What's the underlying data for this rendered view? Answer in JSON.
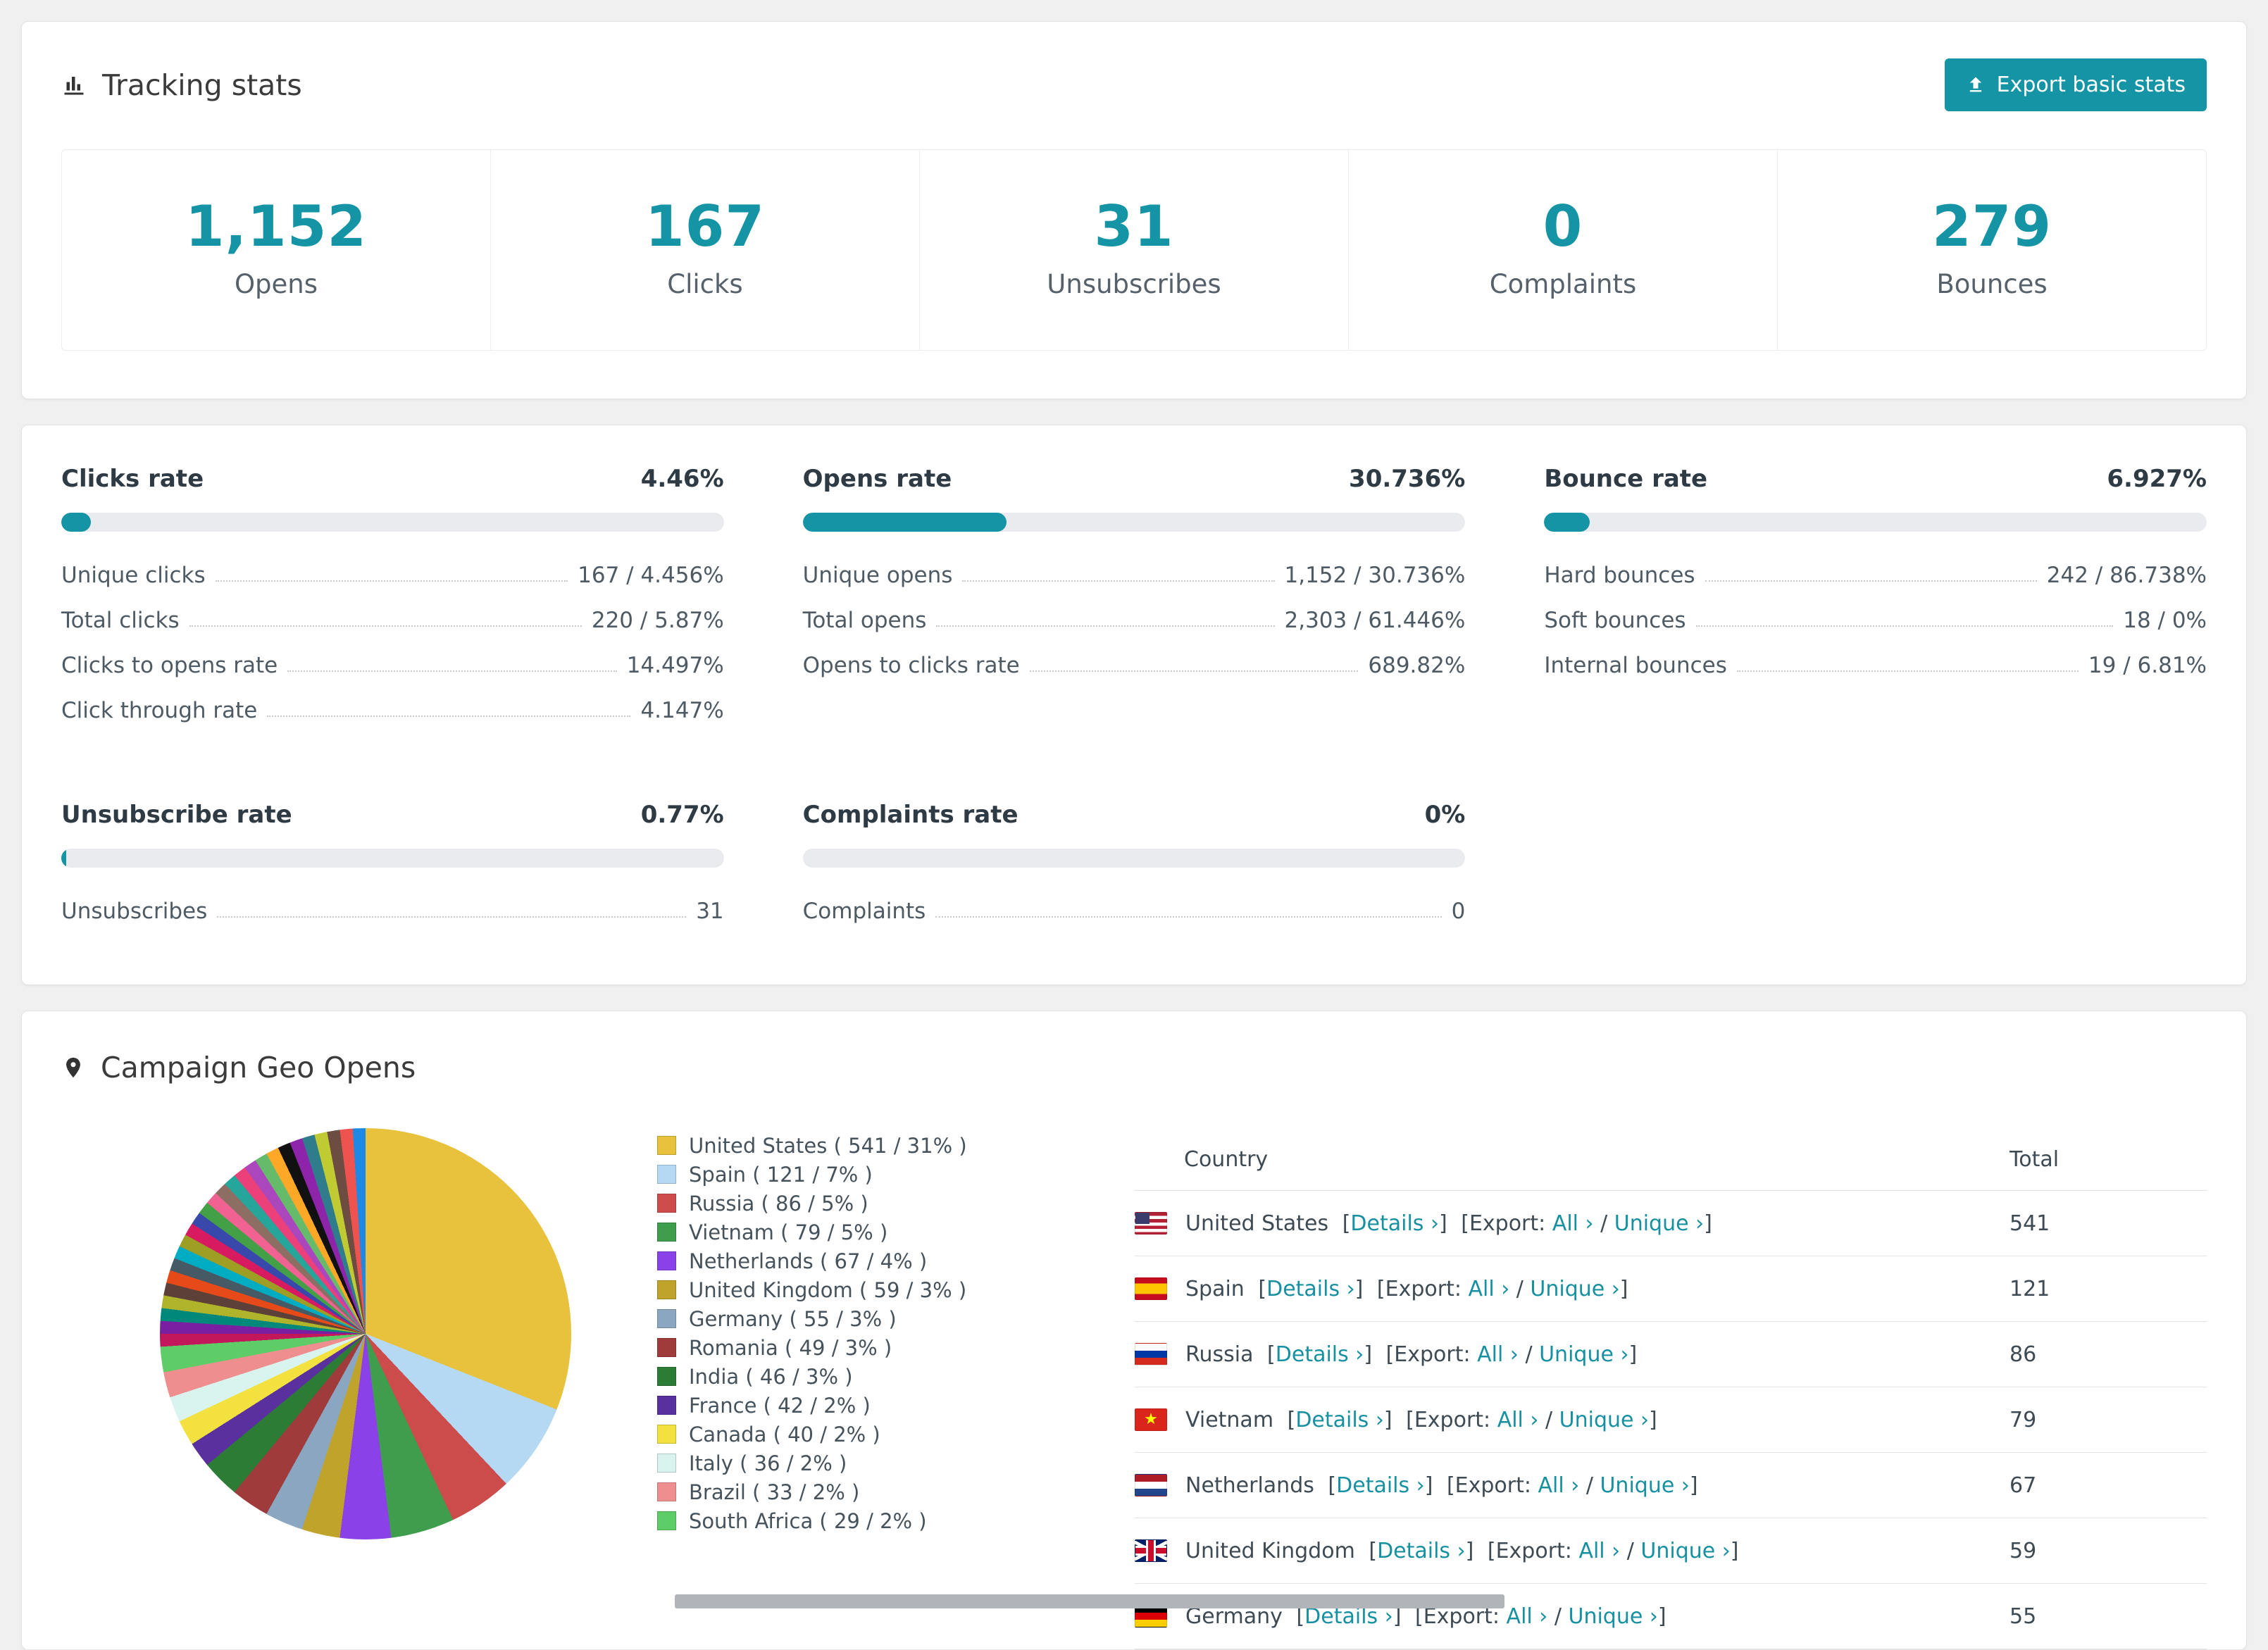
{
  "theme": {
    "accent": "#1594a5",
    "link": "#1791a2",
    "page_bg": "#f0f0f1",
    "bar_bg": "#e9ebee"
  },
  "tracking": {
    "title": "Tracking stats",
    "export_button_label": "Export basic stats",
    "stats": [
      {
        "value": "1,152",
        "label": "Opens"
      },
      {
        "value": "167",
        "label": "Clicks"
      },
      {
        "value": "31",
        "label": "Unsubscribes"
      },
      {
        "value": "0",
        "label": "Complaints"
      },
      {
        "value": "279",
        "label": "Bounces"
      }
    ]
  },
  "rates": {
    "blocks": [
      {
        "title": "Clicks rate",
        "value": "4.46%",
        "percent": 4.46,
        "rows": [
          {
            "label": "Unique clicks",
            "value": "167 / 4.456%"
          },
          {
            "label": "Total clicks",
            "value": "220 / 5.87%"
          },
          {
            "label": "Clicks to opens rate",
            "value": "14.497%"
          },
          {
            "label": "Click through rate",
            "value": "4.147%"
          }
        ]
      },
      {
        "title": "Opens rate",
        "value": "30.736%",
        "percent": 30.736,
        "rows": [
          {
            "label": "Unique opens",
            "value": "1,152 / 30.736%"
          },
          {
            "label": "Total opens",
            "value": "2,303 / 61.446%"
          },
          {
            "label": "Opens to clicks rate",
            "value": "689.82%"
          }
        ]
      },
      {
        "title": "Bounce rate",
        "value": "6.927%",
        "percent": 6.927,
        "rows": [
          {
            "label": "Hard bounces",
            "value": "242 / 86.738%"
          },
          {
            "label": "Soft bounces",
            "value": "18 / 0%"
          },
          {
            "label": "Internal bounces",
            "value": "19 / 6.81%"
          }
        ]
      },
      {
        "title": "Unsubscribe rate",
        "value": "0.77%",
        "percent": 0.77,
        "rows": [
          {
            "label": "Unsubscribes",
            "value": "31"
          }
        ]
      },
      {
        "title": "Complaints rate",
        "value": "0%",
        "percent": 0,
        "rows": [
          {
            "label": "Complaints",
            "value": "0"
          }
        ]
      }
    ]
  },
  "geo": {
    "title": "Campaign Geo Opens",
    "table": {
      "headers": {
        "country": "Country",
        "total": "Total"
      },
      "labels": {
        "lb": "[",
        "rb": "]",
        "slash": "/",
        "details": "Details ›",
        "export": "Export:",
        "all": "All ›",
        "unique": "Unique ›"
      },
      "rows": [
        {
          "country": "United States",
          "flag": "us",
          "total": "541"
        },
        {
          "country": "Spain",
          "flag": "es",
          "total": "121"
        },
        {
          "country": "Russia",
          "flag": "ru",
          "total": "86"
        },
        {
          "country": "Vietnam",
          "flag": "vn",
          "total": "79"
        },
        {
          "country": "Netherlands",
          "flag": "nl",
          "total": "67"
        },
        {
          "country": "United Kingdom",
          "flag": "gb",
          "total": "59"
        },
        {
          "country": "Germany",
          "flag": "de",
          "total": "55"
        }
      ]
    },
    "chart_data": {
      "type": "pie",
      "title": "Campaign Geo Opens",
      "legend_position": "right",
      "series": [
        {
          "label": "United States",
          "value": 541,
          "percent": 31,
          "color": "#e8c23d"
        },
        {
          "label": "Spain",
          "value": 121,
          "percent": 7,
          "color": "#b5d9f3"
        },
        {
          "label": "Russia",
          "value": 86,
          "percent": 5,
          "color": "#cc4b4b"
        },
        {
          "label": "Vietnam",
          "value": 79,
          "percent": 5,
          "color": "#3f9e4d"
        },
        {
          "label": "Netherlands",
          "value": 67,
          "percent": 4,
          "color": "#8b41e8"
        },
        {
          "label": "United Kingdom",
          "value": 59,
          "percent": 3,
          "color": "#bfa32b"
        },
        {
          "label": "Germany",
          "value": 55,
          "percent": 3,
          "color": "#8aa6c0"
        },
        {
          "label": "Romania",
          "value": 49,
          "percent": 3,
          "color": "#a03b3b"
        },
        {
          "label": "India",
          "value": 46,
          "percent": 3,
          "color": "#2c7c35"
        },
        {
          "label": "France",
          "value": 42,
          "percent": 2,
          "color": "#5a2f9e"
        },
        {
          "label": "Canada",
          "value": 40,
          "percent": 2,
          "color": "#f2e13f"
        },
        {
          "label": "Italy",
          "value": 36,
          "percent": 2,
          "color": "#d9f3ef"
        },
        {
          "label": "Brazil",
          "value": 33,
          "percent": 2,
          "color": "#ef8e8e"
        },
        {
          "label": "South Africa",
          "value": 29,
          "percent": 2,
          "color": "#5ecd67"
        }
      ],
      "other_slice_colors": [
        "#c2185b",
        "#7b1fa2",
        "#00897b",
        "#afb42b",
        "#5d4037",
        "#e64a19",
        "#455a64",
        "#00acc1",
        "#9e9d24",
        "#d81b60",
        "#3949ab",
        "#43a047",
        "#f06292",
        "#8d6e63",
        "#26a69a",
        "#ec407a",
        "#ab47bc",
        "#66bb6a",
        "#ffa726",
        "#111111",
        "#8e24aa",
        "#2f7d8c",
        "#c0ca33",
        "#6d4c41",
        "#ef5350",
        "#1e88e5"
      ]
    }
  }
}
